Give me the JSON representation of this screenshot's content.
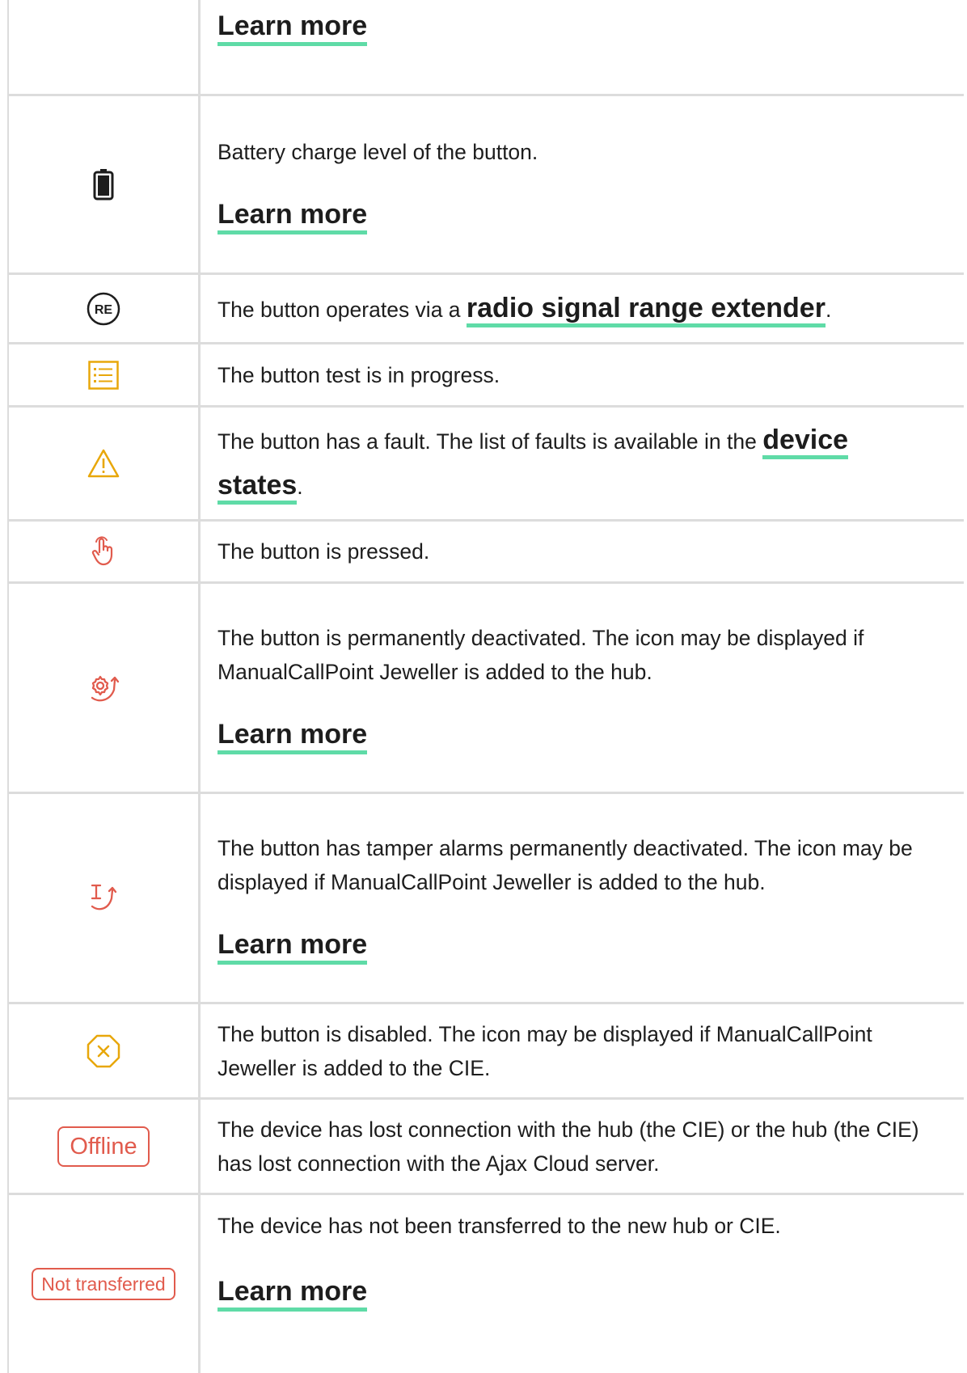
{
  "rows": [
    {
      "id": "r0",
      "text": "",
      "link": "Learn more"
    },
    {
      "id": "r1",
      "icon": "battery-icon",
      "text": "Battery charge level of the button.",
      "link": "Learn more"
    },
    {
      "id": "r2",
      "icon": "re-extender-icon",
      "icon_label": "RE",
      "text": "The button operates via a ",
      "inline_link": "radio signal range extender",
      "after": "."
    },
    {
      "id": "r3",
      "icon": "test-list-icon",
      "text": "The button test is in progress."
    },
    {
      "id": "r4",
      "icon": "warning-icon",
      "text": "The button has a fault. The list of faults is available in the ",
      "inline_link": "device states",
      "after": "."
    },
    {
      "id": "r5",
      "icon": "pressed-hand-icon",
      "text": "The button is pressed."
    },
    {
      "id": "r6",
      "icon": "gear-deactivated-icon",
      "text": "The button is permanently deactivated. The icon may be displayed if ManualCallPoint Jeweller is added to the hub.",
      "link": "Learn more"
    },
    {
      "id": "r7",
      "icon": "tamper-deactivated-icon",
      "text": "The button has tamper alarms permanently deactivated. The icon may be displayed if ManualCallPoint Jeweller is added to the hub.",
      "link": "Learn more"
    },
    {
      "id": "r8",
      "icon": "disabled-octagon-icon",
      "text": "The button is disabled. The icon may be displayed if ManualCallPoint Jeweller is added to the CIE."
    },
    {
      "id": "r9",
      "badge": "Offline",
      "text": "The device has lost connection with the hub (the CIE) or the hub (the CIE) has lost connection with the Ajax Cloud server."
    },
    {
      "id": "r10",
      "badge": "Not transferred",
      "text": "The device has not been transferred to the new hub or CIE.",
      "link": "Learn more"
    }
  ],
  "colors": {
    "accent_underline": "#5fdba7",
    "warning": "#e8a70a",
    "alert_red": "#e15b4d",
    "border": "#dcdcdc"
  }
}
